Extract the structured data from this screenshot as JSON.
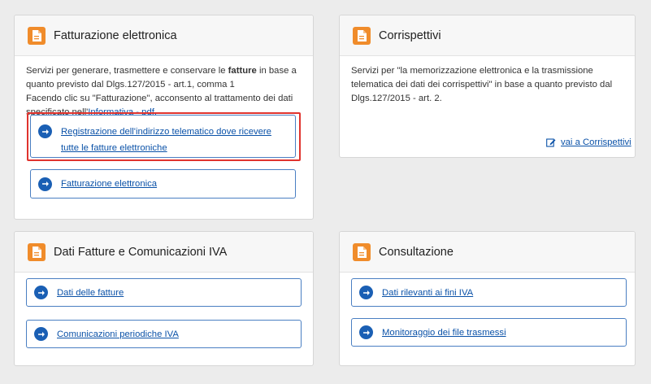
{
  "fatturazione": {
    "title": "Fatturazione elettronica",
    "desc_before": "Servizi per generare, trasmettere e conservare le ",
    "desc_bold": "fatture",
    "desc_after": " in base a quanto previsto dal Dlgs.127/2015 - art.1, comma 1",
    "consent_before": "Facendo clic su \"Fatturazione\", acconsento al trattamento dei dati specificato nell'",
    "consent_link": "Informativa - pdf.",
    "btn_registrazione": "Registrazione dell'indirizzo telematico dove ricevere tutte le fatture elettroniche",
    "btn_fatturazione": "Fatturazione elettronica"
  },
  "corrispettivi": {
    "title": "Corrispettivi",
    "desc": "Servizi per \"la memorizzazione elettronica e la trasmissione telematica dei dati dei corrispettivi\" in base a quanto previsto dal Dlgs.127/2015 - art. 2.",
    "link": "vai a Corrispettivi"
  },
  "dati_fatture": {
    "title": "Dati Fatture e Comunicazioni IVA",
    "btn_dati": "Dati delle fatture",
    "btn_comunicazioni": "Comunicazioni periodiche IVA"
  },
  "consultazione": {
    "title": "Consultazione",
    "btn_rilevanti": "Dati rilevanti ai fini IVA",
    "btn_monitoraggio": "Monitoraggio dei file trasmessi"
  },
  "icons": {
    "header": "document-icon",
    "button": "arrow-right-circle-icon",
    "edit": "edit-icon"
  },
  "colors": {
    "accent_orange": "#f08c2b",
    "link_blue": "#0b52a8",
    "highlight_red": "#e0332e"
  }
}
